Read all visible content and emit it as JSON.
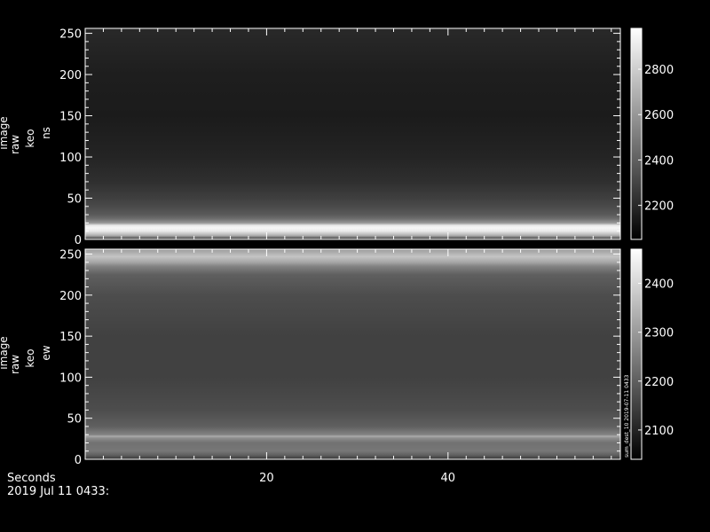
{
  "chart_data": [
    {
      "type": "heatmap",
      "panel": "top",
      "ylabel_lines": [
        "image",
        "raw",
        "keo",
        "ns"
      ],
      "xlim": [
        0,
        59
      ],
      "ylim": [
        0,
        256
      ],
      "yticks": [
        0,
        50,
        100,
        150,
        200,
        250
      ],
      "colorbar": {
        "range": [
          2050,
          2980
        ],
        "ticks": [
          2200,
          2400,
          2600,
          2800
        ]
      },
      "intensity_profile": {
        "description": "bright band near bottom rows",
        "rows": [
          0,
          5,
          10,
          14,
          17,
          20,
          25,
          30,
          40,
          50,
          70,
          100,
          150,
          200,
          256
        ],
        "values": [
          2250,
          2700,
          2900,
          2950,
          2900,
          2600,
          2450,
          2380,
          2320,
          2280,
          2220,
          2180,
          2150,
          2160,
          2200
        ]
      }
    },
    {
      "type": "heatmap",
      "panel": "bottom",
      "ylabel_lines": [
        "image",
        "raw",
        "keo",
        "ew"
      ],
      "xlim": [
        0,
        59
      ],
      "ylim": [
        0,
        256
      ],
      "yticks": [
        0,
        50,
        100,
        150,
        200,
        250
      ],
      "colorbar": {
        "range": [
          2040,
          2470
        ],
        "ticks": [
          2100,
          2200,
          2300,
          2400
        ],
        "side_label": "sum_dest_10 2019-07-11 0433"
      },
      "intensity_profile": {
        "description": "bright bands near bottom and top rows",
        "rows": [
          0,
          5,
          10,
          20,
          26,
          28,
          30,
          40,
          60,
          100,
          150,
          200,
          225,
          235,
          240,
          247,
          256
        ],
        "values": [
          2130,
          2200,
          2240,
          2230,
          2280,
          2330,
          2260,
          2200,
          2170,
          2150,
          2150,
          2170,
          2200,
          2260,
          2320,
          2370,
          2300
        ]
      }
    }
  ],
  "shared_x": {
    "xlabel": "Seconds",
    "xticks": [
      20,
      40
    ]
  },
  "footer": {
    "timestamp": "2019 Jul 11 0433:"
  },
  "colors": {
    "background": "#000000",
    "axis": "#ffffff",
    "colormap": "grayscale"
  }
}
